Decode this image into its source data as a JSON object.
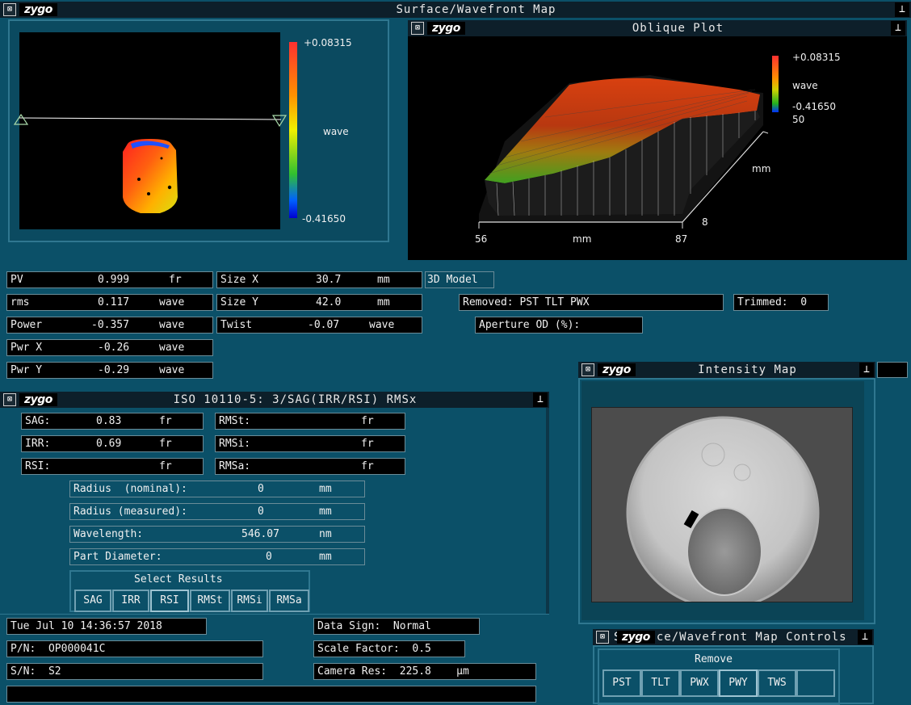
{
  "main_window": {
    "logo": "zygo",
    "title": "Surface/Wavefront Map"
  },
  "surface_map": {
    "max": "+0.08315",
    "min": "-0.41650",
    "unit": "wave"
  },
  "oblique": {
    "logo": "zygo",
    "title": "Oblique Plot",
    "max": "+0.08315",
    "min": "-0.41650",
    "unit": "wave",
    "axis_y_top": "50",
    "axis_y_unit": "mm",
    "axis_y_bottom": "8",
    "axis_x_left": "56",
    "axis_x_unit": "mm",
    "axis_x_right": "87"
  },
  "results": {
    "pv": {
      "label": "PV",
      "value": "0.999",
      "unit": "fr"
    },
    "rms": {
      "label": "rms",
      "value": "0.117",
      "unit": "wave"
    },
    "power": {
      "label": "Power",
      "value": "-0.357",
      "unit": "wave"
    },
    "pwr_x": {
      "label": "Pwr X",
      "value": "-0.26",
      "unit": "wave"
    },
    "pwr_y": {
      "label": "Pwr Y",
      "value": "-0.29",
      "unit": "wave"
    },
    "size_x": {
      "label": "Size X",
      "value": "30.7",
      "unit": "mm"
    },
    "size_y": {
      "label": "Size Y",
      "value": "42.0",
      "unit": "mm"
    },
    "twist": {
      "label": "Twist",
      "value": "-0.07",
      "unit": "wave"
    },
    "model_button": "3D Model",
    "removed": "Removed: PST TLT PWX",
    "trimmed": "Trimmed:  0",
    "aperture": "Aperture OD (%):"
  },
  "iso": {
    "logo": "zygo",
    "title": "ISO 10110-5: 3/SAG(IRR/RSI) RMSx",
    "sag": {
      "label": "SAG:",
      "value": "0.83",
      "unit": "fr"
    },
    "irr": {
      "label": "IRR:",
      "value": "0.69",
      "unit": "fr"
    },
    "rsi": {
      "label": "RSI:",
      "value": "",
      "unit": "fr"
    },
    "rmst": {
      "label": "RMSt:",
      "unit": "fr"
    },
    "rmsi": {
      "label": "RMSi:",
      "unit": "fr"
    },
    "rmsa": {
      "label": "RMSa:",
      "unit": "fr"
    },
    "radius_nominal": {
      "label": "Radius  (nominal):",
      "value": "0",
      "unit": "mm"
    },
    "radius_measured": {
      "label": "Radius (measured):",
      "value": "0",
      "unit": "mm"
    },
    "wavelength": {
      "label": "Wavelength:",
      "value": "546.07",
      "unit": "nm"
    },
    "part_diameter": {
      "label": "Part Diameter:",
      "value": "0",
      "unit": "mm"
    },
    "select_results": "Select Results",
    "buttons": [
      "SAG",
      "IRR",
      "RSI",
      "RMSt",
      "RMSi",
      "RMSa"
    ]
  },
  "intensity": {
    "logo": "zygo",
    "title": "Intensity Map"
  },
  "status": {
    "datetime": "Tue Jul 10 14:36:57 2018",
    "pn": "P/N:  OP000041C",
    "sn": "S/N:  S2",
    "data_sign": "Data Sign:  Normal",
    "scale_factor": "Scale Factor:  0.5",
    "camera_res": "Camera Res:  225.8    µm"
  },
  "controls": {
    "logo": "zygo",
    "title_prefix": "S",
    "title": "ce/Wavefront Map Controls",
    "group": "Remove",
    "buttons": [
      "PST",
      "TLT",
      "PWX",
      "PWY",
      "TWS",
      ""
    ]
  }
}
